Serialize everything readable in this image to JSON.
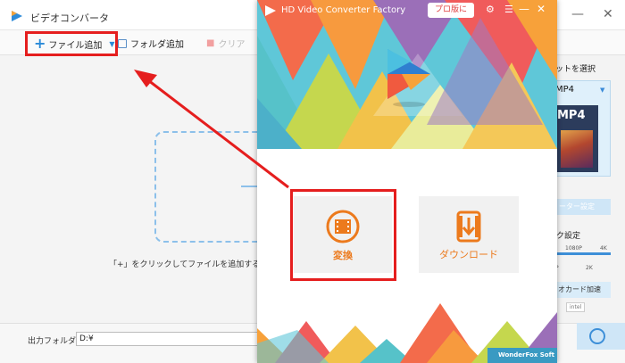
{
  "background_window": {
    "title": "ビデオコンバータ",
    "toolbar": {
      "add_file_label": "ファイル追加",
      "add_folder_label": "フォルダ追加",
      "clear_label": "クリア"
    },
    "hint": "「+」をクリックしてファイルを追加するか、",
    "output_folder_label": "出力フォルダ：",
    "output_folder_value": "D:¥",
    "right_panel": {
      "header": "ットを選択",
      "format": "MP4",
      "thumb_label": "MP4",
      "param_button": "ーター設定",
      "quality_label": "ク設定",
      "quality_ticks": [
        "1080P",
        "4K",
        "P",
        "2K"
      ],
      "gpu_label": "オカード加速",
      "gpu_option": "intel"
    }
  },
  "foreground_window": {
    "title": "HD Video Converter Factory",
    "pro_button": "プロ版に",
    "convert_label": "変換",
    "download_label": "ダウンロード",
    "brand": "WonderFox Soft"
  },
  "colors": {
    "highlight": "#e51e1e",
    "accent_orange": "#ec7a1d",
    "accent_blue": "#2a8ad8"
  }
}
